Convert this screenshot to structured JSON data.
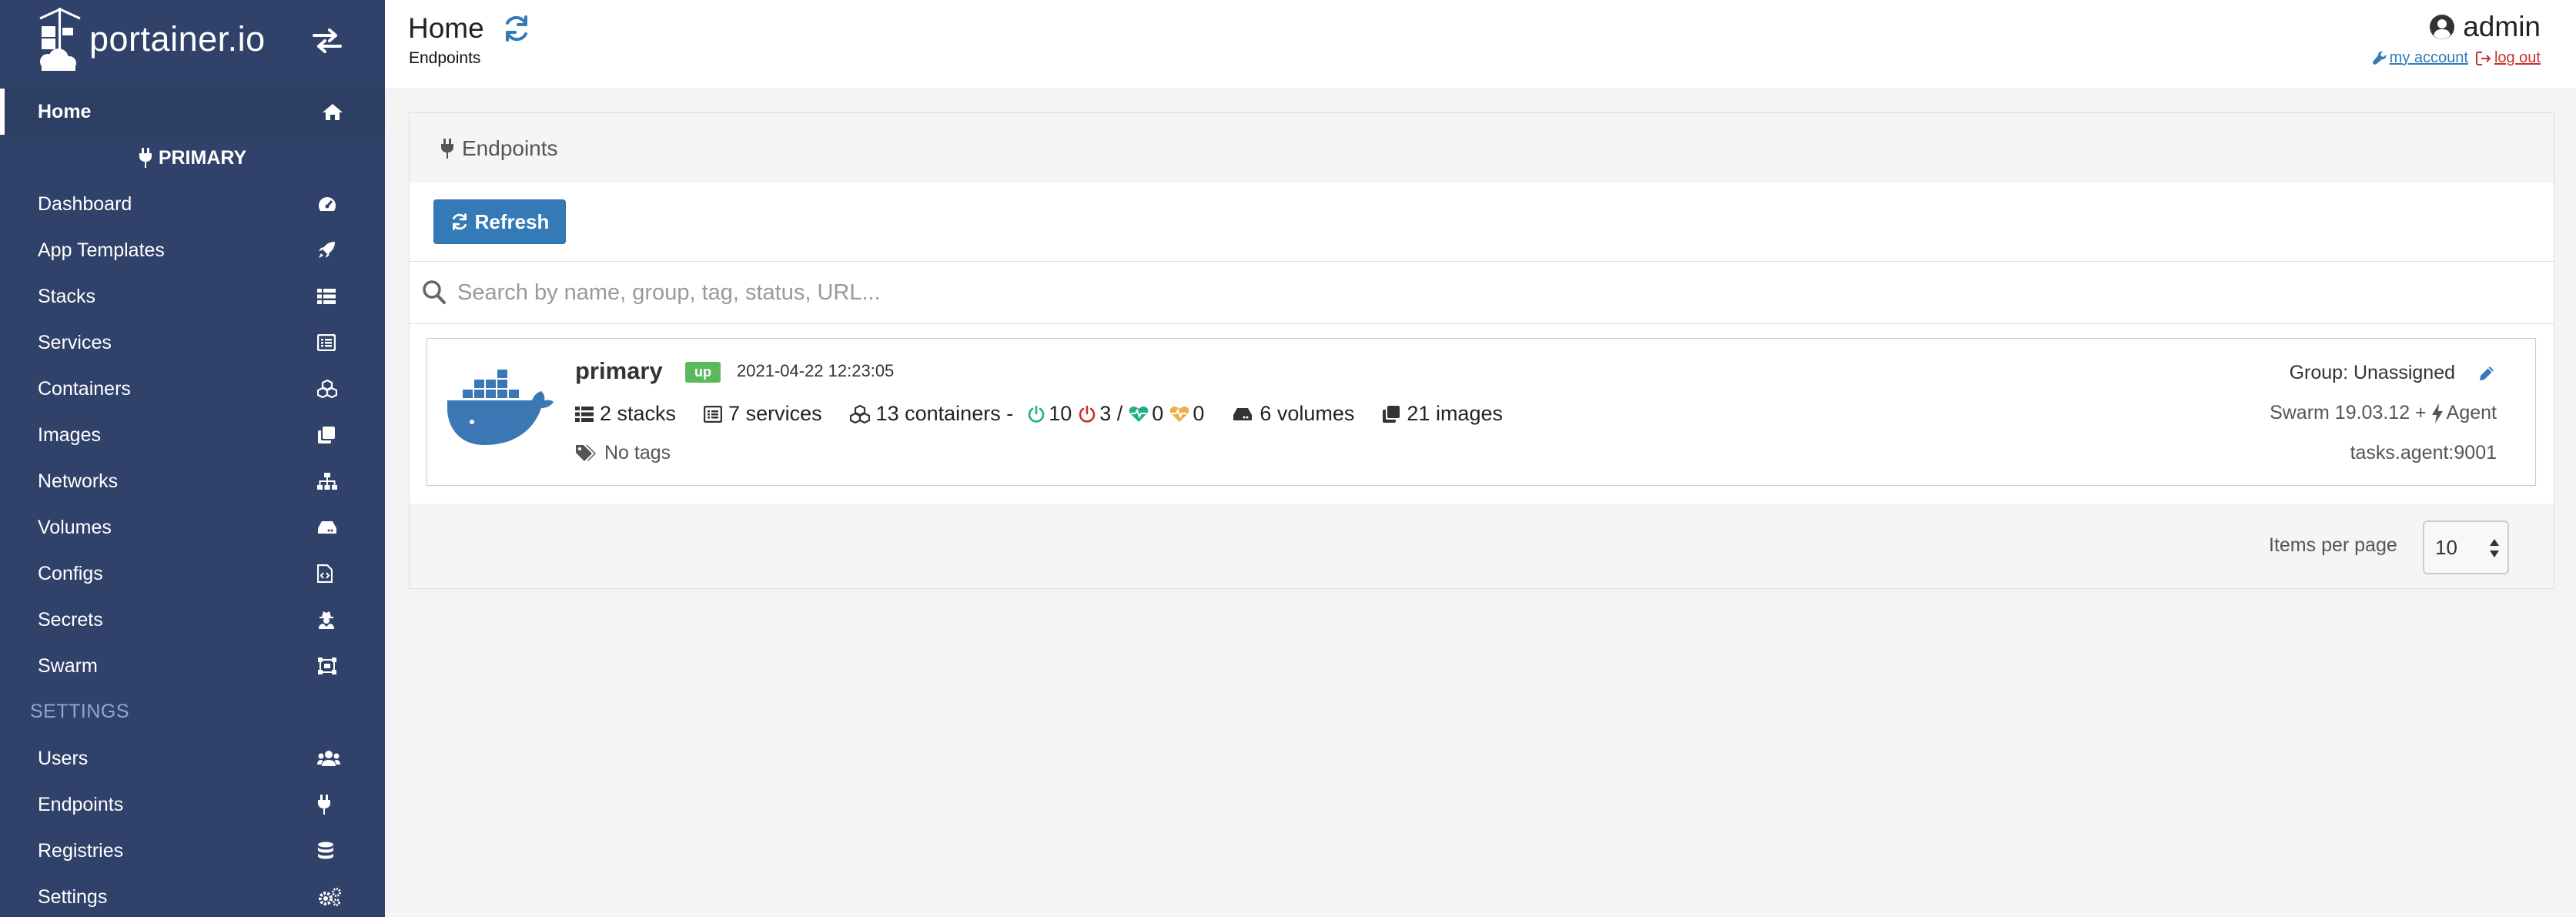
{
  "app": {
    "name": "portainer.io"
  },
  "sidebar": {
    "home": "Home",
    "endpoint_name": "PRIMARY",
    "items": [
      {
        "label": "Dashboard",
        "icon": "tachometer-icon"
      },
      {
        "label": "App Templates",
        "icon": "rocket-icon"
      },
      {
        "label": "Stacks",
        "icon": "th-list-icon"
      },
      {
        "label": "Services",
        "icon": "list-alt-icon"
      },
      {
        "label": "Containers",
        "icon": "cubes-icon"
      },
      {
        "label": "Images",
        "icon": "clone-icon"
      },
      {
        "label": "Networks",
        "icon": "sitemap-icon"
      },
      {
        "label": "Volumes",
        "icon": "hdd-icon"
      },
      {
        "label": "Configs",
        "icon": "file-code-icon"
      },
      {
        "label": "Secrets",
        "icon": "user-secret-icon"
      },
      {
        "label": "Swarm",
        "icon": "object-group-icon"
      }
    ],
    "settings_heading": "SETTINGS",
    "settings_items": [
      {
        "label": "Users",
        "icon": "users-icon"
      },
      {
        "label": "Endpoints",
        "icon": "plug-icon"
      },
      {
        "label": "Registries",
        "icon": "database-icon"
      },
      {
        "label": "Settings",
        "icon": "cogs-icon"
      }
    ]
  },
  "header": {
    "title": "Home",
    "breadcrumb": "Endpoints",
    "username": "admin",
    "my_account": "my account",
    "log_out": "log out"
  },
  "widget": {
    "title": "Endpoints",
    "refresh_label": "Refresh",
    "search_placeholder": "Search by name, group, tag, status, URL...",
    "items_per_page_label": "Items per page",
    "items_per_page_value": "10"
  },
  "endpoint": {
    "name": "primary",
    "status": "up",
    "timestamp": "2021-04-22 12:23:05",
    "stacks": "2 stacks",
    "services": "7 services",
    "containers": "13 containers -",
    "running": "10",
    "stopped": "3 /",
    "healthy": "0",
    "unhealthy": "0",
    "volumes": "6 volumes",
    "images": "21 images",
    "tags": "No tags",
    "group": "Group: Unassigned",
    "version": "Swarm 19.03.12 +",
    "agent": "Agent",
    "url": "tasks.agent:9001"
  },
  "colors": {
    "sidebar_bg": "#30426a",
    "primary_blue": "#337ab7",
    "status_green": "#5cb85c",
    "logout_red": "#c9302c",
    "running_green": "#23ae89",
    "stopped_red": "#c9302c",
    "unhealthy_orange": "#f0ad4e",
    "docker_blue": "#3b77b4"
  }
}
